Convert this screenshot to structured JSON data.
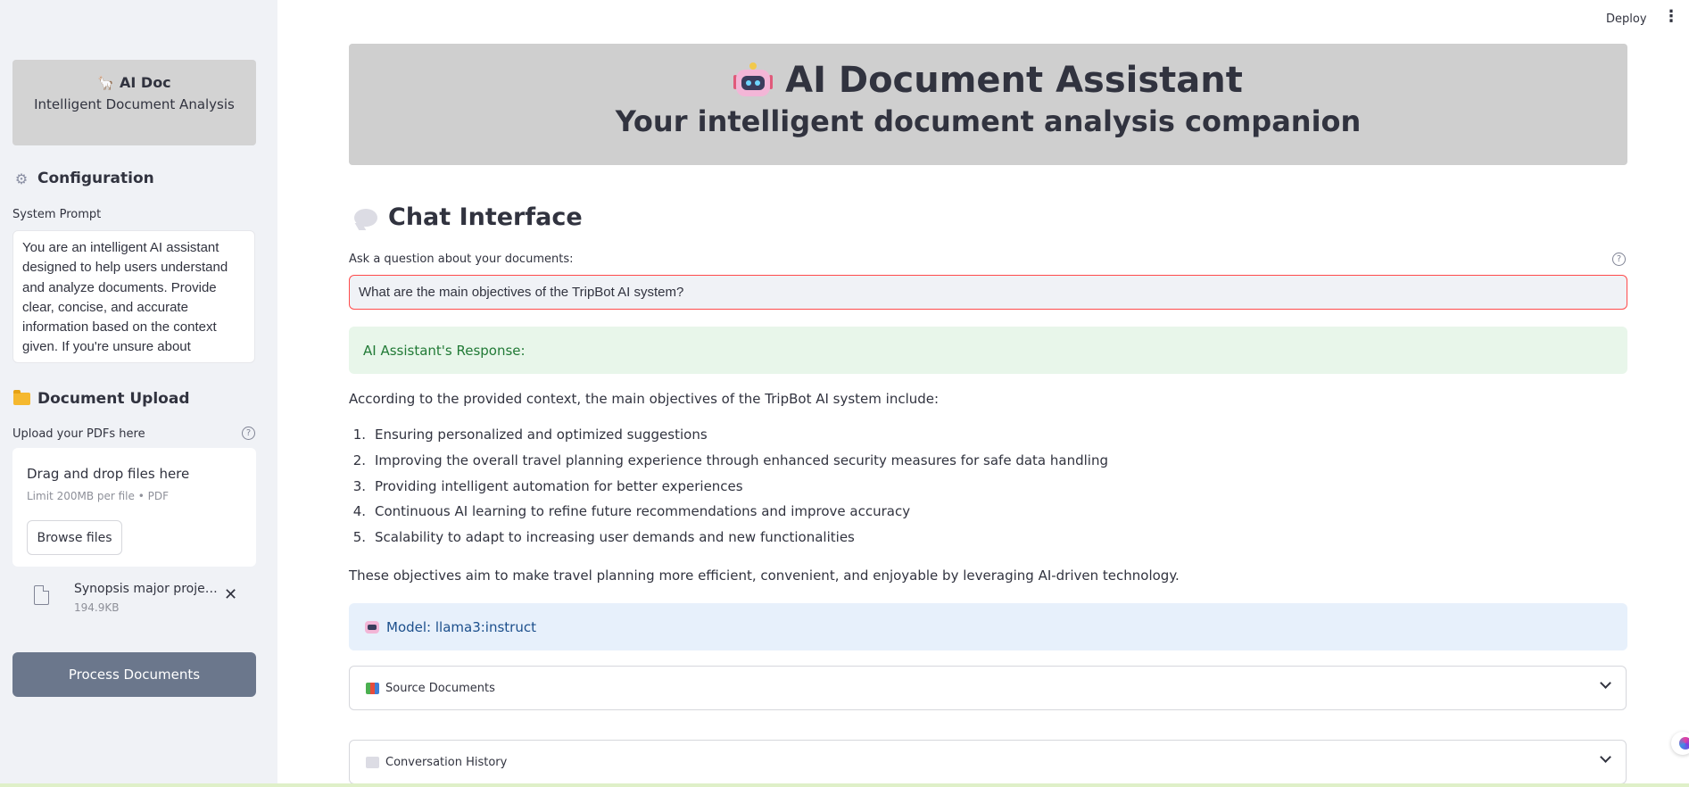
{
  "topbar": {
    "deploy_label": "Deploy",
    "menu_icon": "kebab-menu-icon"
  },
  "sidebar": {
    "brand": {
      "title": "AI Doc",
      "subtitle": "Intelligent Document Analysis",
      "icon": "llama-icon"
    },
    "configuration": {
      "heading": "Configuration",
      "icon": "gear-icon",
      "system_prompt_label": "System Prompt",
      "system_prompt_value": "You are an intelligent AI assistant designed to help users understand and analyze documents. Provide clear, concise, and accurate information based on the context given. If you're unsure about"
    },
    "upload": {
      "heading": "Document Upload",
      "icon": "folder-icon",
      "label": "Upload your PDFs here",
      "help_icon": "?",
      "drop_title": "Drag and drop files here",
      "drop_limit": "Limit 200MB per file • PDF",
      "browse_label": "Browse files",
      "file": {
        "name": "Synopsis major project…",
        "size": "194.9KB",
        "close_icon": "✕"
      }
    },
    "process_button": "Process Documents"
  },
  "main": {
    "hero": {
      "title": "AI Document Assistant",
      "subtitle": "Your intelligent document analysis companion",
      "icon": "robot-icon"
    },
    "chat": {
      "heading": "Chat Interface",
      "icon": "speech-bubble-icon",
      "ask_label": "Ask a question about your documents:",
      "help_icon": "?",
      "question_value": "What are the main objectives of the TripBot AI system?"
    },
    "response": {
      "label": "AI Assistant's Response:",
      "intro": "According to the provided context, the main objectives of the TripBot AI system include:",
      "items": [
        {
          "num": "1.",
          "text": "Ensuring personalized and optimized suggestions"
        },
        {
          "num": "2.",
          "text": "Improving the overall travel planning experience through enhanced security measures for safe data handling"
        },
        {
          "num": "3.",
          "text": "Providing intelligent automation for better experiences"
        },
        {
          "num": "4.",
          "text": "Continuous AI learning to refine future recommendations and improve accuracy"
        },
        {
          "num": "5.",
          "text": "Scalability to adapt to increasing user demands and new functionalities"
        }
      ],
      "outro": "These objectives aim to make travel planning more efficient, convenient, and enjoyable by leveraging AI-driven technology."
    },
    "model": {
      "label": "Model: llama3:instruct",
      "icon": "robot-icon"
    },
    "expanders": [
      {
        "label": "Source Documents",
        "icon": "books-icon"
      },
      {
        "label": "Conversation History",
        "icon": "speech-bubble-icon"
      }
    ]
  }
}
